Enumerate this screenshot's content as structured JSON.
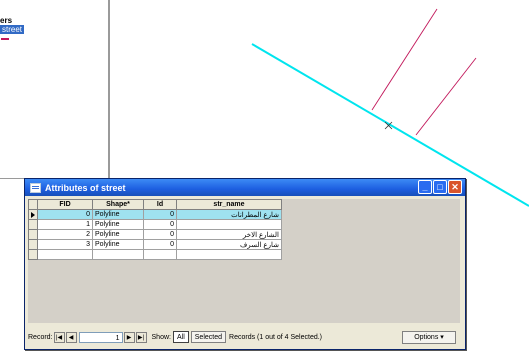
{
  "toc": {
    "layer_label": "ers",
    "street_label": "street",
    "street_color": "#c2185b"
  },
  "map": {
    "street_color": "#c2185b",
    "highlight_color": "#00e5ee"
  },
  "window": {
    "title": "Attributes of street",
    "buttons": {
      "minimize": "_",
      "maximize": "□",
      "close": "✕"
    }
  },
  "table": {
    "headers": {
      "fid": "FID",
      "shape": "Shape*",
      "id": "Id",
      "str_name": "str_name"
    },
    "rows": [
      {
        "fid": "0",
        "shape": "Polyline",
        "id": "0",
        "str_name": "شارع المطرانات",
        "selected": true
      },
      {
        "fid": "1",
        "shape": "Polyline",
        "id": "0",
        "str_name": "",
        "selected": false
      },
      {
        "fid": "2",
        "shape": "Polyline",
        "id": "0",
        "str_name": "الشارع الاخر",
        "selected": false
      },
      {
        "fid": "3",
        "shape": "Polyline",
        "id": "0",
        "str_name": "شارع السرف",
        "selected": false
      }
    ],
    "selection_color": "#9fe2f0"
  },
  "navbar": {
    "record_label": "Record:",
    "record_value": "1",
    "show_label": "Show:",
    "all_label": "All",
    "selected_label": "Selected",
    "records_text": "Records (1 out of 4 Selected.)",
    "options_label": "Options ▾"
  }
}
